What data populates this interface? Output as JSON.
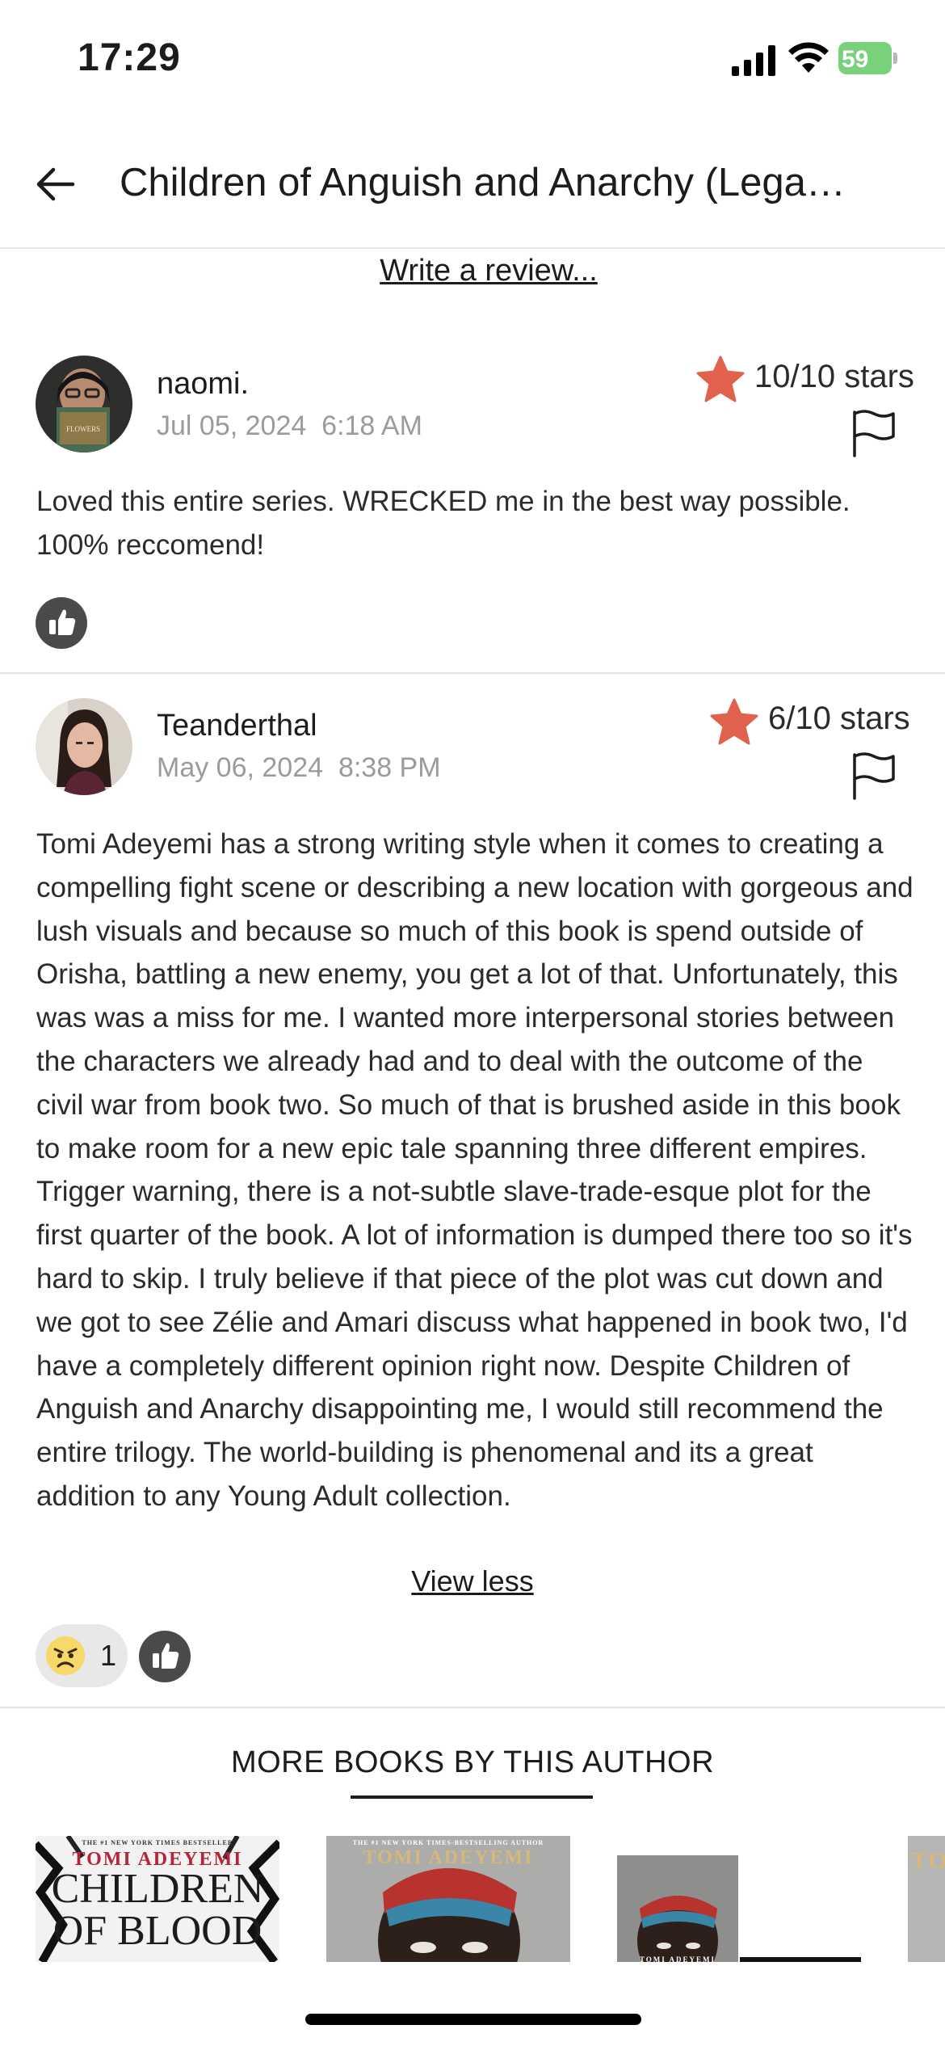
{
  "status_bar": {
    "time": "17:29",
    "battery": "59"
  },
  "header": {
    "title": "Children of Anguish and Anarchy (Legacy of Orïsha)"
  },
  "write_review_label": "Write a review...",
  "reviews": [
    {
      "username": "naomi.",
      "date": "Jul 05, 2024",
      "time": "6:18 AM",
      "rating": "10/10 stars",
      "body": "Loved this entire series. WRECKED me in the best way possible. 100% reccomend!"
    },
    {
      "username": "Teanderthal",
      "date": "May 06, 2024",
      "time": "8:38 PM",
      "rating": "6/10 stars",
      "body": "Tomi Adeyemi has a strong writing style when it comes to creating a compelling fight scene or describing a new location with gorgeous and lush visuals and because so much of this book is spend outside of Orisha, battling a new enemy, you get a lot of that. Unfortunately, this was was a miss for me. I wanted more interpersonal stories between the characters we already had and to deal with the outcome of the civil war from book two. So much of that is brushed aside in this book to make room for a new epic tale spanning three different empires. Trigger warning, there is a not-subtle slave-trade-esque plot for the first quarter of the book. A lot of information is dumped there too so it's hard to skip. I truly believe if that piece of the plot was cut down and we got to see Zélie and Amari discuss what happened in book two, I'd have a completely different opinion right now. Despite Children of Anguish and Anarchy disappointing me, I would still recommend the entire trilogy. The world-building is phenomenal and its a great addition to any Young Adult collection.",
      "view_less_label": "View less",
      "reaction_count": "1"
    }
  ],
  "more_books": {
    "heading": "MORE BOOKS BY THIS AUTHOR",
    "books": [
      {
        "tagline": "THE #1 NEW YORK TIMES BESTSELLER",
        "author": "TOMI ADEYEMI",
        "title": "CHILDREN OF BLOOD"
      },
      {
        "tagline": "THE #1 NEW YORK TIMES-BESTSELLING AUTHOR",
        "author": "TOMI ADEYEMI",
        "title": ""
      },
      {
        "tagline": "",
        "author": "TOMI ADEYEMI",
        "title": ""
      },
      {
        "tagline": "",
        "author": "TO",
        "title": ""
      }
    ]
  },
  "colors": {
    "star": "#e0624d",
    "battery": "#7ad17b",
    "like": "#4a4a4a",
    "date": "#9b9b9b"
  },
  "icons": [
    "back-arrow-icon",
    "star-icon",
    "flag-icon",
    "thumbs-up-icon",
    "angry-face-icon",
    "signal-icon",
    "wifi-icon",
    "battery-icon"
  ]
}
